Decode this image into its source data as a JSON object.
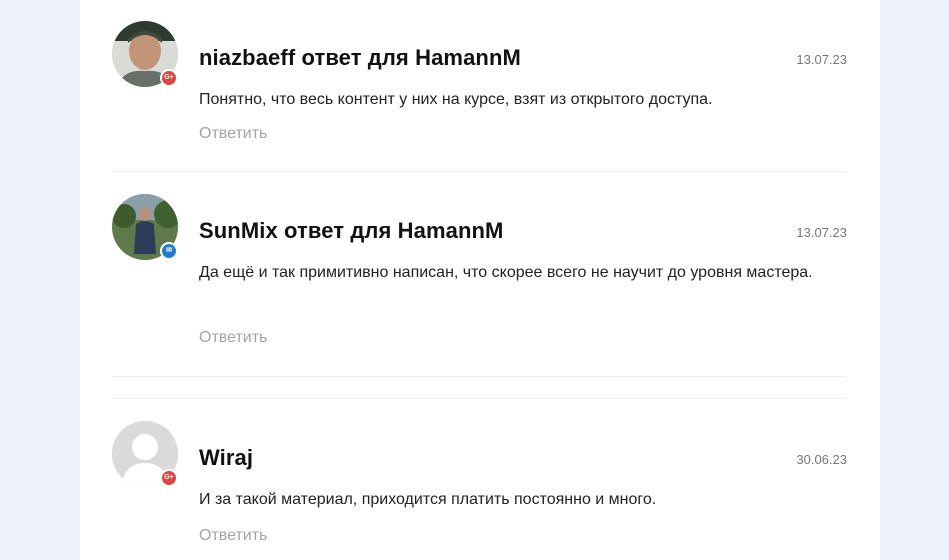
{
  "comments": [
    {
      "author": "niazbaeff ответ для HamannM",
      "date": "13.07.23",
      "text": "Понятно, что весь контент у них на курсе, взят из открытого доступа.",
      "reply": "Ответить",
      "badge": "G+"
    },
    {
      "author": "SunMix ответ для HamannM",
      "date": "13.07.23",
      "text": "Да ещё и так примитивно написан, что скорее всего не научит до уровня мастера.",
      "reply": "Ответить",
      "badge": "✉"
    },
    {
      "author": "Wiraj",
      "date": "30.06.23",
      "text": "И за такой материал, приходится платить постоянно и много.",
      "reply": "Ответить",
      "badge": "G+"
    }
  ],
  "colors": {
    "page_background": "#edf2fc",
    "panel": "#ffffff",
    "gplus_badge": "#e0473c",
    "mail_badge": "#1f7ccf",
    "reply_text": "#a3a3a3"
  },
  "icons": [
    "gplus-icon",
    "mail-icon",
    "default-avatar-icon"
  ]
}
